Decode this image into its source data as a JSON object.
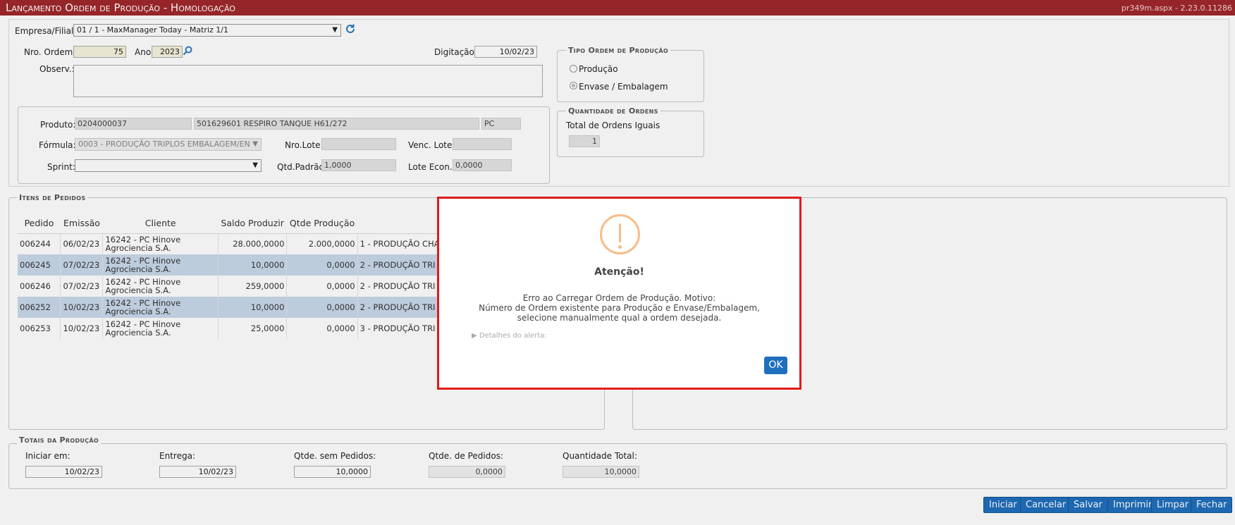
{
  "window": {
    "title": "Lançamento Ordem de Produção  - Homologação",
    "version": "pr349m.aspx - 2.23.0.11286"
  },
  "header": {
    "empresa_label": "Empresa/Filial:",
    "empresa_value": "01 / 1 - MaxManager Today - Matriz 1/1",
    "nro_ordem_label": "Nro. Ordem:",
    "nro_ordem_value": "75",
    "ano_label": "Ano:",
    "ano_value": "2023",
    "digitacao_label": "Digitação:",
    "digitacao_value": "10/02/23",
    "observ_label": "Observ.:"
  },
  "tipo_ordem": {
    "legend": "Tipo Ordem de Produção",
    "options": [
      {
        "label": "Produção",
        "selected": false
      },
      {
        "label": "Envase / Embalagem",
        "selected": true
      }
    ]
  },
  "quantidade_ordens": {
    "legend": "Quantidade de Ordens",
    "label": "Total de Ordens Iguais",
    "value": "1"
  },
  "produto": {
    "produto_label": "Produto:",
    "codigo": "0204000037",
    "descricao": "501629601 RESPIRO TANQUE H61/272",
    "unidade": "PC",
    "formula_label": "Fórmula:",
    "formula_value": "0003 - PRODUÇÃO TRIPLOS EMBALAGEM/EN",
    "nro_lote_label": "Nro.Lote:",
    "nro_lote_value": "",
    "venc_lote_label": "Venc. Lote:",
    "venc_lote_value": "",
    "sprint_label": "Sprint:",
    "sprint_value": "",
    "qtd_padrao_label": "Qtd.Padrão:",
    "qtd_padrao_value": "1,0000",
    "lote_econ_label": "Lote Econ.:",
    "lote_econ_value": "0,0000"
  },
  "itens_pedidos": {
    "legend": "Itens de Pedidos",
    "columns": [
      "Pedido",
      "Emissão",
      "Cliente",
      "Saldo Produzir",
      "Qtde Produção"
    ],
    "rows": [
      {
        "pedido": "006244",
        "emissao": "06/02/23",
        "cliente": "16242 - PC Hinove Agrociencia S.A.",
        "saldo": "28.000,0000",
        "qtde": "2.000,0000",
        "extra": "1 - PRODUÇÃO CHA"
      },
      {
        "pedido": "006245",
        "emissao": "07/02/23",
        "cliente": "16242 - PC Hinove Agrociencia S.A.",
        "saldo": "10,0000",
        "qtde": "0,0000",
        "extra": "2 - PRODUÇÃO TRI"
      },
      {
        "pedido": "006246",
        "emissao": "07/02/23",
        "cliente": "16242 - PC Hinove Agrociencia S.A.",
        "saldo": "259,0000",
        "qtde": "0,0000",
        "extra": "2 - PRODUÇÃO TRI"
      },
      {
        "pedido": "006252",
        "emissao": "10/02/23",
        "cliente": "16242 - PC Hinove Agrociencia S.A.",
        "saldo": "10,0000",
        "qtde": "0,0000",
        "extra": "2 - PRODUÇÃO TRI"
      },
      {
        "pedido": "006253",
        "emissao": "10/02/23",
        "cliente": "16242 - PC Hinove Agrociencia S.A.",
        "saldo": "25,0000",
        "qtde": "0,0000",
        "extra": "3 - PRODUÇÃO TRI"
      }
    ]
  },
  "totais": {
    "legend": "Totais da Produção",
    "iniciar_label": "Iniciar em:",
    "iniciar_value": "10/02/23",
    "entrega_label": "Entrega:",
    "entrega_value": "10/02/23",
    "sem_pedidos_label": "Qtde. sem Pedidos:",
    "sem_pedidos_value": "10,0000",
    "de_pedidos_label": "Qtde. de Pedidos:",
    "de_pedidos_value": "0,0000",
    "total_label": "Quantidade Total:",
    "total_value": "10,0000"
  },
  "buttons": {
    "iniciar": "Iniciar",
    "cancelar": "Cancelar",
    "salvar": "Salvar",
    "imprimir": "Imprimir",
    "limpar": "Limpar",
    "fechar": "Fechar"
  },
  "dialog": {
    "title": "Atenção!",
    "message_lines": [
      "Erro ao Carregar Ordem de Produção. Motivo:",
      "Número de Ordem existente para Produção e Envase/Embalagem,",
      "selecione manualmente qual a ordem desejada."
    ],
    "details": "▶ Detalhes do alerta:",
    "ok": "OK"
  },
  "colors": {
    "titlebar": "#a0282c",
    "accent_button": "#1f6fbd",
    "alert_border": "#e11a1a",
    "warning_icon": "#f8bb86",
    "row_highlight": "#c9d9ea"
  }
}
